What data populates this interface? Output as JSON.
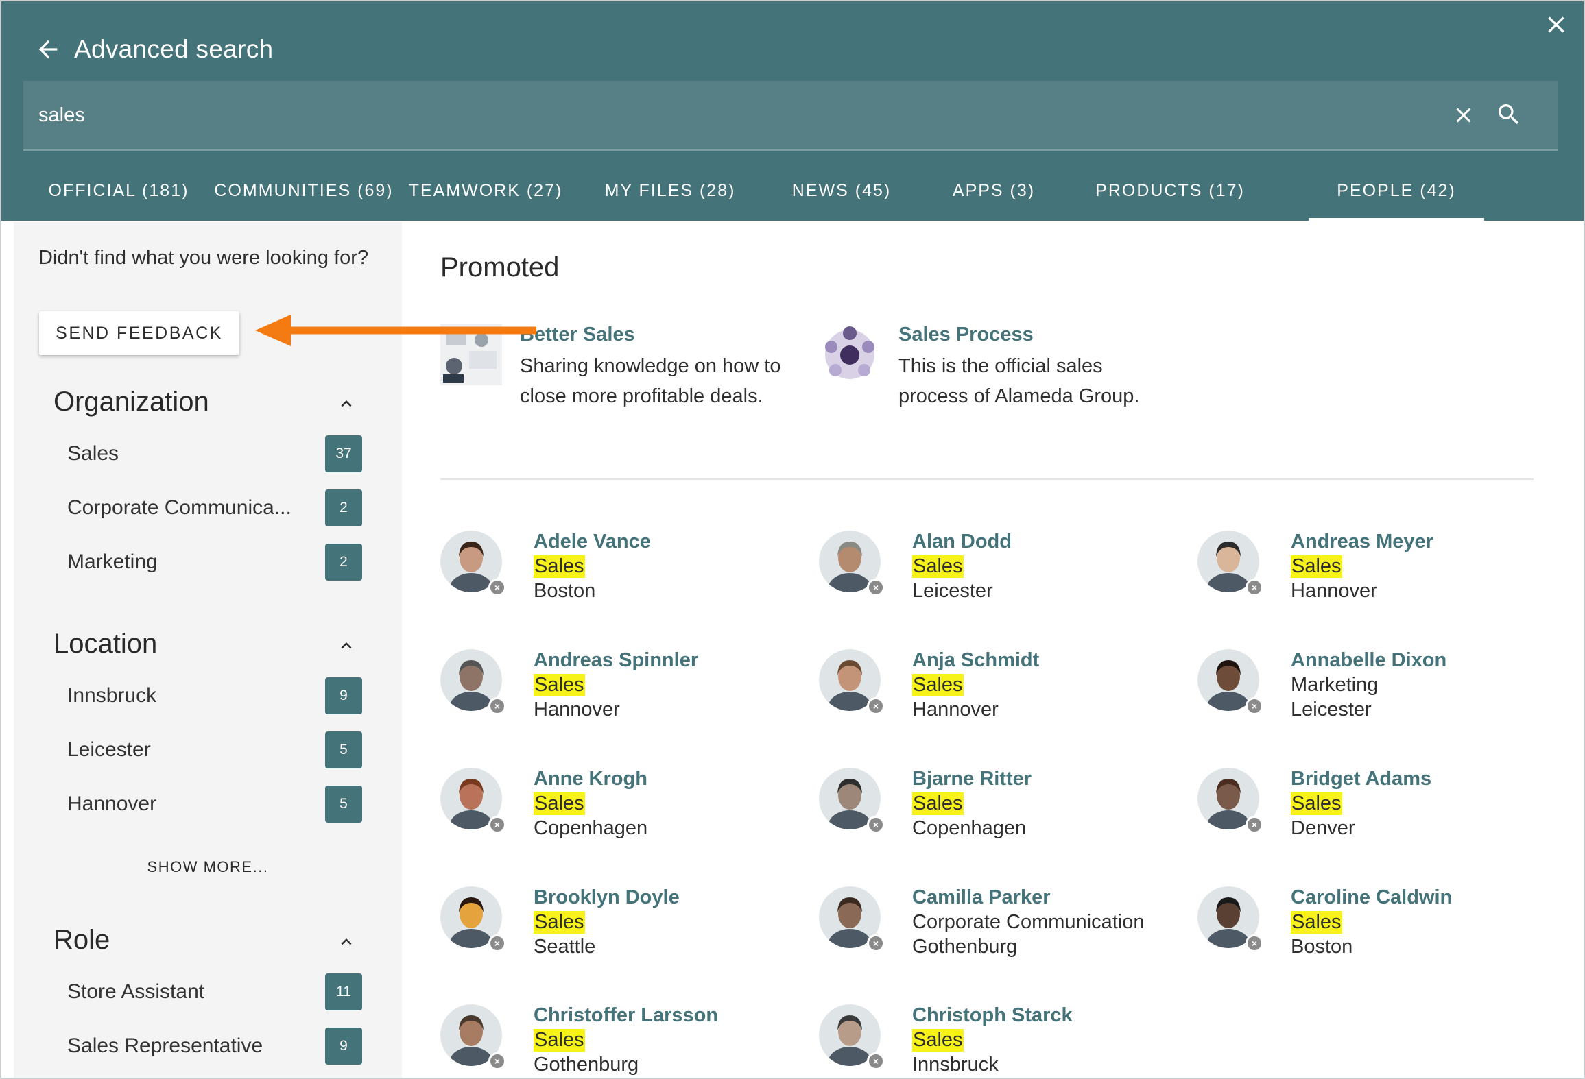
{
  "header": {
    "title": "Advanced search",
    "search_value": "sales",
    "accent": "#44737a"
  },
  "tabs": [
    {
      "label": "OFFICIAL (181)"
    },
    {
      "label": "COMMUNITIES (69)"
    },
    {
      "label": "TEAMWORK (27)"
    },
    {
      "label": "MY FILES (28)"
    },
    {
      "label": "NEWS (45)"
    },
    {
      "label": "APPS (3)"
    },
    {
      "label": "PRODUCTS (17)"
    },
    {
      "label": "PEOPLE (42)",
      "active": true
    }
  ],
  "sidebar": {
    "feedback_question": "Didn't find what you were looking for?",
    "feedback_button": "SEND FEEDBACK",
    "organization": {
      "title": "Organization",
      "items": [
        {
          "label": "Sales",
          "count": "37"
        },
        {
          "label": "Corporate Communica...",
          "count": "2"
        },
        {
          "label": "Marketing",
          "count": "2"
        }
      ]
    },
    "location": {
      "title": "Location",
      "items": [
        {
          "label": "Innsbruck",
          "count": "9"
        },
        {
          "label": "Leicester",
          "count": "5"
        },
        {
          "label": "Hannover",
          "count": "5"
        }
      ],
      "show_more": "SHOW MORE..."
    },
    "role": {
      "title": "Role",
      "items": [
        {
          "label": "Store Assistant",
          "count": "11"
        },
        {
          "label": "Sales Representative",
          "count": "9"
        }
      ]
    }
  },
  "promoted": {
    "heading": "Promoted",
    "items": [
      {
        "title": "Better Sales",
        "description": "Sharing knowledge on how to close more profitable deals."
      },
      {
        "title": "Sales Process",
        "description": "This is the official sales process of Alameda Group."
      }
    ]
  },
  "people": [
    {
      "name": "Adele Vance",
      "dept": "Sales",
      "city": "Boston",
      "highlight": true
    },
    {
      "name": "Alan Dodd",
      "dept": "Sales",
      "city": "Leicester",
      "highlight": true
    },
    {
      "name": "Andreas Meyer",
      "dept": "Sales",
      "city": "Hannover",
      "highlight": true
    },
    {
      "name": "Andreas Spinnler",
      "dept": "Sales",
      "city": "Hannover",
      "highlight": true
    },
    {
      "name": "Anja Schmidt",
      "dept": "Sales",
      "city": "Hannover",
      "highlight": true
    },
    {
      "name": "Annabelle Dixon",
      "dept": "Marketing",
      "city": "Leicester",
      "highlight": false
    },
    {
      "name": "Anne Krogh",
      "dept": "Sales",
      "city": "Copenhagen",
      "highlight": true
    },
    {
      "name": "Bjarne Ritter",
      "dept": "Sales",
      "city": "Copenhagen",
      "highlight": true
    },
    {
      "name": "Bridget Adams",
      "dept": "Sales",
      "city": "Denver",
      "highlight": true
    },
    {
      "name": "Brooklyn Doyle",
      "dept": "Sales",
      "city": "Seattle",
      "highlight": true
    },
    {
      "name": "Camilla Parker",
      "dept": "Corporate Communication",
      "city": "Gothenburg",
      "highlight": false
    },
    {
      "name": "Caroline Caldwin",
      "dept": "Sales",
      "city": "Boston",
      "highlight": true
    },
    {
      "name": "Christoffer Larsson",
      "dept": "Sales",
      "city": "Gothenburg",
      "highlight": true
    },
    {
      "name": "Christoph Starck",
      "dept": "Sales",
      "city": "Innsbruck",
      "highlight": true
    }
  ],
  "colors": {
    "header_bg": "#44737a",
    "search_bg": "#567f86",
    "highlight": "#f7f21a",
    "link": "#44737a",
    "annotation_arrow": "#f47b12"
  }
}
